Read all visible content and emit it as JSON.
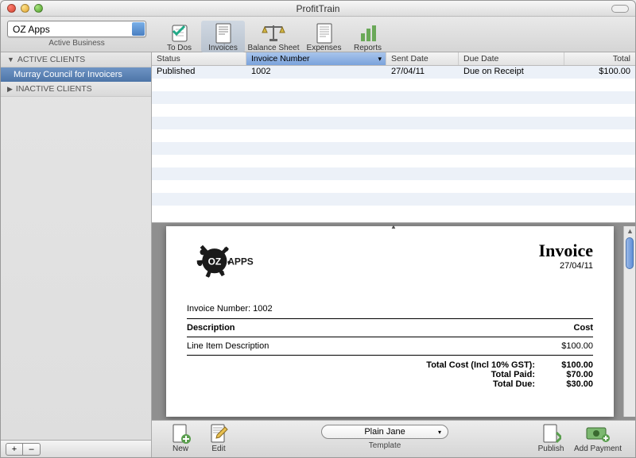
{
  "window": {
    "title": "ProfitTrain"
  },
  "toolbar": {
    "business": "OZ Apps",
    "business_label": "Active Business",
    "items": [
      "To Dos",
      "Invoices",
      "Balance Sheet",
      "Expenses",
      "Reports"
    ]
  },
  "sidebar": {
    "sections": [
      {
        "title": "ACTIVE CLIENTS",
        "items": [
          "Murray Council for Invoicers"
        ]
      },
      {
        "title": "INACTIVE CLIENTS",
        "items": []
      }
    ],
    "add": "+",
    "remove": "–"
  },
  "table": {
    "columns": [
      "Status",
      "Invoice Number",
      "Sent Date",
      "Due Date",
      "Total"
    ],
    "rows": [
      {
        "status": "Published",
        "number": "1002",
        "sent": "27/04/11",
        "due": "Due on Receipt",
        "total": "$100.00"
      }
    ]
  },
  "preview": {
    "logo_text": "OZ APPS",
    "title": "Invoice",
    "date": "27/04/11",
    "inv_no_label": "Invoice Number:",
    "inv_no": "1002",
    "col_desc": "Description",
    "col_cost": "Cost",
    "line_desc": "Line Item Description",
    "line_cost": "$100.00",
    "totals": [
      {
        "label": "Total Cost (Incl 10% GST):",
        "value": "$100.00"
      },
      {
        "label": "Total Paid:",
        "value": "$70.00"
      },
      {
        "label": "Total Due:",
        "value": "$30.00"
      }
    ]
  },
  "bottom": {
    "new": "New",
    "edit": "Edit",
    "template": "Plain Jane",
    "template_label": "Template",
    "publish": "Publish",
    "add_payment": "Add Payment"
  }
}
